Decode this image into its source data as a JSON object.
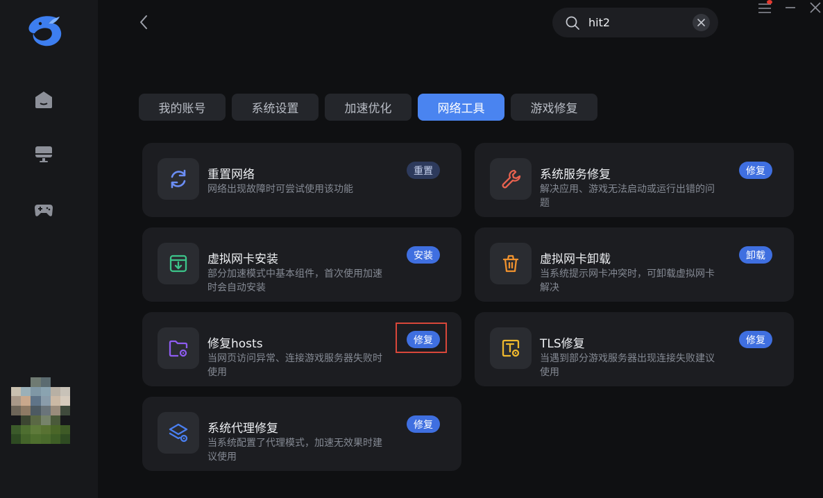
{
  "search": {
    "value": "hit2",
    "clear_icon": "close-icon"
  },
  "sidebar": {
    "items": [
      {
        "name": "home",
        "icon": "home-icon"
      },
      {
        "name": "monitor",
        "icon": "monitor-icon"
      },
      {
        "name": "games",
        "icon": "gamepad-icon"
      }
    ]
  },
  "tabs": [
    {
      "label": "我的账号",
      "active": false
    },
    {
      "label": "系统设置",
      "active": false
    },
    {
      "label": "加速优化",
      "active": false
    },
    {
      "label": "网络工具",
      "active": true
    },
    {
      "label": "游戏修复",
      "active": false
    }
  ],
  "cards": [
    {
      "title": "重置网络",
      "desc": "网络出现故障时可尝试使用该功能",
      "button": "重置",
      "icon": "refresh-icon",
      "icon_color": "#6b8ef5"
    },
    {
      "title": "系统服务修复",
      "desc": "解决应用、游戏无法启动或运行出错的问题",
      "button": "修复",
      "icon": "wrench-icon",
      "icon_color": "#e8624f"
    },
    {
      "title": "虚拟网卡安装",
      "desc": "部分加速模式中基本组件，首次使用加速时会自动安装",
      "button": "安装",
      "icon": "install-box-icon",
      "icon_color": "#3cc58a"
    },
    {
      "title": "虚拟网卡卸载",
      "desc": "当系统提示网卡冲突时，可卸载虚拟网卡解决",
      "button": "卸载",
      "icon": "trash-icon",
      "icon_color": "#f0922e"
    },
    {
      "title": "修复hosts",
      "desc": "当网页访问异常、连接游戏服务器失败时使用",
      "button": "修复",
      "icon": "folder-gear-icon",
      "icon_color": "#8e5cf0"
    },
    {
      "title": "TLS修复",
      "desc": "当遇到部分游戏服务器出现连接失败建议使用",
      "button": "修复",
      "icon": "tls-gear-icon",
      "icon_color": "#f0b92e"
    },
    {
      "title": "系统代理修复",
      "desc": "当系统配置了代理模式，加速无效果时建议使用",
      "button": "修复",
      "icon": "layers-gear-icon",
      "icon_color": "#4a7ff0"
    }
  ]
}
